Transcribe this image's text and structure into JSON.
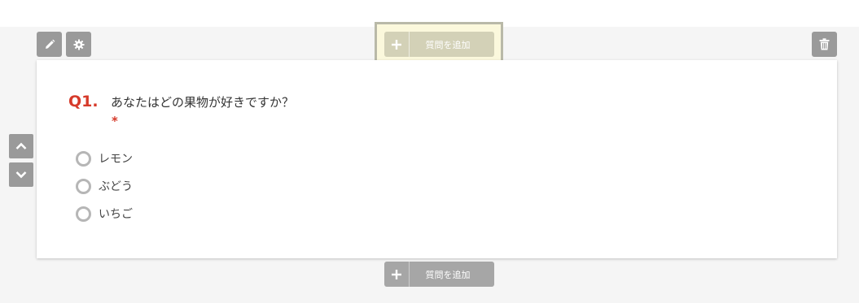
{
  "toolbar": {
    "edit_icon": "pencil-icon",
    "settings_icon": "gear-icon",
    "delete_icon": "trash-icon"
  },
  "add_question_top": {
    "label": "質問を追加",
    "icon": "plus-icon"
  },
  "add_question_bottom": {
    "label": "質問を追加",
    "icon": "plus-icon"
  },
  "question": {
    "number": "Q1.",
    "text": "あなたはどの果物が好きですか？",
    "required_mark": "*",
    "options": [
      {
        "label": "レモン"
      },
      {
        "label": "ぶどう"
      },
      {
        "label": "いちご"
      }
    ]
  },
  "reorder": {
    "up_icon": "chevron-up-icon",
    "down_icon": "chevron-down-icon"
  },
  "colors": {
    "accent_red": "#d63a2a",
    "highlight_bg": "#fbf8dc",
    "button_gray": "#9a9a9a"
  }
}
